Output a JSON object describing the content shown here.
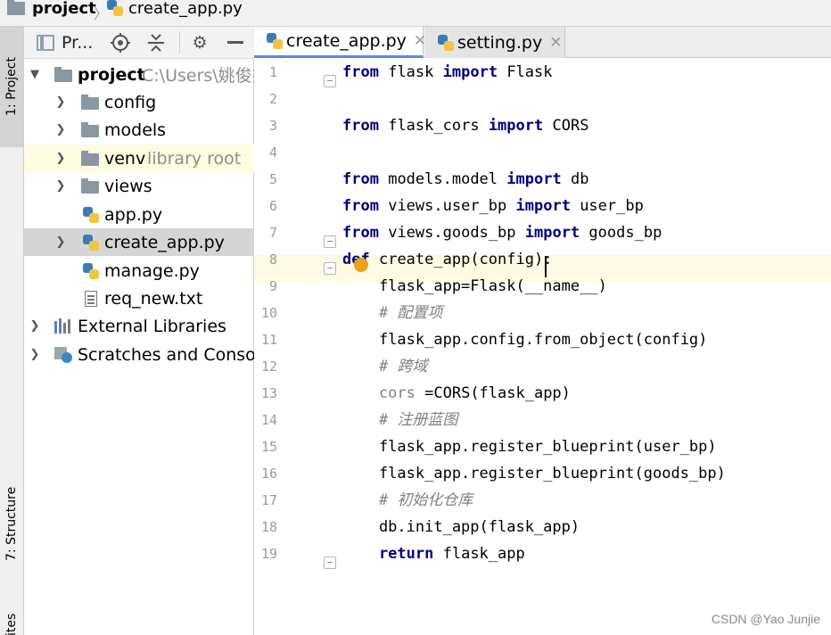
{
  "breadcrumb": {
    "project": "project",
    "file": "create_app.py"
  },
  "tool_strip": {
    "project": "1: Project",
    "structure": "7: Structure",
    "favorites": "ites"
  },
  "project_toolbar": {
    "view_label": "Pr..."
  },
  "tree": [
    {
      "label": "project",
      "extra": "C:\\Users\\姚俊杰",
      "type": "folder",
      "expanded": true
    },
    {
      "label": "config",
      "type": "folder"
    },
    {
      "label": "models",
      "type": "folder"
    },
    {
      "label": "venv",
      "extra": "library root",
      "type": "folder"
    },
    {
      "label": "views",
      "type": "folder"
    },
    {
      "label": "app.py",
      "type": "python"
    },
    {
      "label": "create_app.py",
      "type": "python",
      "selected": true
    },
    {
      "label": "manage.py",
      "type": "python"
    },
    {
      "label": "req_new.txt",
      "type": "text"
    },
    {
      "label": "External Libraries",
      "type": "library"
    },
    {
      "label": "Scratches and Consoles",
      "type": "scratch"
    }
  ],
  "tabs": [
    {
      "label": "create_app.py",
      "active": true
    },
    {
      "label": "setting.py",
      "active": false
    }
  ],
  "code_lines": [
    {
      "n": "1",
      "tokens": [
        [
          "kw",
          "from"
        ],
        [
          "",
          "flask"
        ],
        [
          "kw",
          "import"
        ],
        [
          "",
          "Flask"
        ]
      ]
    },
    {
      "n": "2",
      "tokens": []
    },
    {
      "n": "3",
      "tokens": [
        [
          "kw",
          "from"
        ],
        [
          "",
          "flask_cors"
        ],
        [
          "kw",
          "import"
        ],
        [
          "",
          "CORS"
        ]
      ]
    },
    {
      "n": "4",
      "tokens": []
    },
    {
      "n": "5",
      "tokens": [
        [
          "kw",
          "from"
        ],
        [
          "",
          "models.model"
        ],
        [
          "kw",
          "import"
        ],
        [
          "",
          "db"
        ]
      ]
    },
    {
      "n": "6",
      "tokens": [
        [
          "kw",
          "from"
        ],
        [
          "",
          "views.user_bp"
        ],
        [
          "kw",
          "import"
        ],
        [
          "",
          "user_bp"
        ]
      ]
    },
    {
      "n": "7",
      "tokens": [
        [
          "kw",
          "from"
        ],
        [
          "",
          "views.goods_bp"
        ],
        [
          "kw",
          "import"
        ],
        [
          "",
          "goods_bp"
        ]
      ]
    },
    {
      "n": "8",
      "tokens": [
        [
          "kw",
          "def"
        ],
        [
          "",
          "create_app(config):"
        ]
      ]
    },
    {
      "n": "9",
      "tokens": [
        [
          "",
          "    flask_app=Flask(__name__)"
        ]
      ]
    },
    {
      "n": "10",
      "tokens": [
        [
          "cm",
          "    # 配置项"
        ]
      ]
    },
    {
      "n": "11",
      "tokens": [
        [
          "",
          "    flask_app.config.from_object(config)"
        ]
      ]
    },
    {
      "n": "12",
      "tokens": [
        [
          "cm",
          "    # 跨域"
        ]
      ]
    },
    {
      "n": "13",
      "tokens": [
        [
          "dim",
          "    cors"
        ],
        [
          "",
          "=CORS(flask_app)"
        ]
      ]
    },
    {
      "n": "14",
      "tokens": [
        [
          "cm",
          "    # 注册蓝图"
        ]
      ]
    },
    {
      "n": "15",
      "tokens": [
        [
          "",
          "    flask_app.register_blueprint(user_bp)"
        ]
      ]
    },
    {
      "n": "16",
      "tokens": [
        [
          "",
          "    flask_app.register_blueprint(goods_bp)"
        ]
      ]
    },
    {
      "n": "17",
      "tokens": [
        [
          "cm",
          "    # 初始化仓库"
        ]
      ]
    },
    {
      "n": "18",
      "tokens": [
        [
          "",
          "    db.init_app(flask_app)"
        ]
      ]
    },
    {
      "n": "19",
      "tokens": [
        [
          "kw",
          "    return"
        ],
        [
          "",
          "flask_app"
        ]
      ]
    }
  ],
  "watermark": "CSDN @Yao Junjie"
}
